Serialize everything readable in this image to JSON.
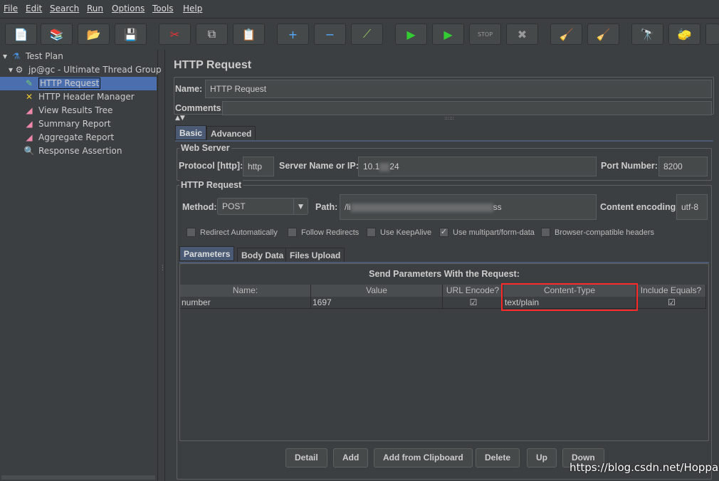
{
  "menu": [
    "File",
    "Edit",
    "Search",
    "Run",
    "Options",
    "Tools",
    "Help"
  ],
  "toolbar": [
    {
      "name": "new",
      "glyph": "📄"
    },
    {
      "name": "templates",
      "glyph": "📚"
    },
    {
      "name": "open",
      "glyph": "📂"
    },
    {
      "name": "save",
      "glyph": "💾"
    },
    {
      "name": "cut",
      "glyph": "✂"
    },
    {
      "name": "copy",
      "glyph": "⧉"
    },
    {
      "name": "paste",
      "glyph": "📋"
    },
    {
      "name": "expand",
      "glyph": "+"
    },
    {
      "name": "collapse",
      "glyph": "−"
    },
    {
      "name": "toggle",
      "glyph": "⟋"
    },
    {
      "name": "start",
      "glyph": "▶"
    },
    {
      "name": "start-no-pauses",
      "glyph": "▶"
    },
    {
      "name": "stop",
      "glyph": "STOP"
    },
    {
      "name": "shutdown",
      "glyph": "✖"
    },
    {
      "name": "clear",
      "glyph": "🧹"
    },
    {
      "name": "clear-all",
      "glyph": "🧹"
    },
    {
      "name": "search",
      "glyph": "🔭"
    },
    {
      "name": "reset-search",
      "glyph": "🧽"
    },
    {
      "name": "more",
      "glyph": ""
    }
  ],
  "tree": [
    {
      "label": "Test Plan",
      "icon": "flask"
    },
    {
      "label": "jp@gc - Ultimate Thread Group",
      "icon": "gear"
    },
    {
      "label": "HTTP Request",
      "icon": "pipette",
      "selected": true
    },
    {
      "label": "HTTP Header Manager",
      "icon": "tools"
    },
    {
      "label": "View Results Tree",
      "icon": "chart"
    },
    {
      "label": "Summary Report",
      "icon": "chart"
    },
    {
      "label": "Aggregate Report",
      "icon": "chart"
    },
    {
      "label": "Response Assertion",
      "icon": "magnifier"
    }
  ],
  "panel": {
    "title": "HTTP Request",
    "name_label": "Name:",
    "name_value": "HTTP Request",
    "comments_label": "Comments:",
    "tabs": [
      "Basic",
      "Advanced"
    ],
    "web_server": {
      "title": "Web Server",
      "protocol_label": "Protocol [http]:",
      "protocol": "http",
      "server_label": "Server Name or IP:",
      "server_prefix": "10.1",
      "server_suffix": "24",
      "port_label": "Port Number:",
      "port": "8200"
    },
    "http_request": {
      "title": "HTTP Request",
      "method_label": "Method:",
      "method": "POST",
      "path_label": "Path:",
      "path_prefix": "/li",
      "path_suffix": "ss",
      "encoding_label": "Content encoding:",
      "encoding": "utf-8"
    },
    "checkboxes": [
      {
        "label": "Redirect Automatically",
        "checked": false
      },
      {
        "label": "Follow Redirects",
        "checked": false
      },
      {
        "label": "Use KeepAlive",
        "checked": false
      },
      {
        "label": "Use multipart/form-data",
        "checked": true
      },
      {
        "label": "Browser-compatible headers",
        "checked": false
      }
    ],
    "subtabs": [
      "Parameters",
      "Body Data",
      "Files Upload"
    ],
    "table_title": "Send Parameters With the Request:",
    "columns": [
      "Name:",
      "Value",
      "URL Encode?",
      "Content-Type",
      "Include Equals?"
    ],
    "rows": [
      {
        "name": "number",
        "value": "1697",
        "url_encode": true,
        "content_type": "text/plain",
        "include_equals": true
      }
    ],
    "buttons": [
      "Detail",
      "Add",
      "Add from Clipboard",
      "Delete",
      "Up",
      "Down"
    ]
  },
  "watermark": "https://blog.csdn.net/Hoppaz",
  "colors": {
    "background": "#3c3f41",
    "selection": "#4b6eaf",
    "highlight": "#ff2a2a"
  }
}
